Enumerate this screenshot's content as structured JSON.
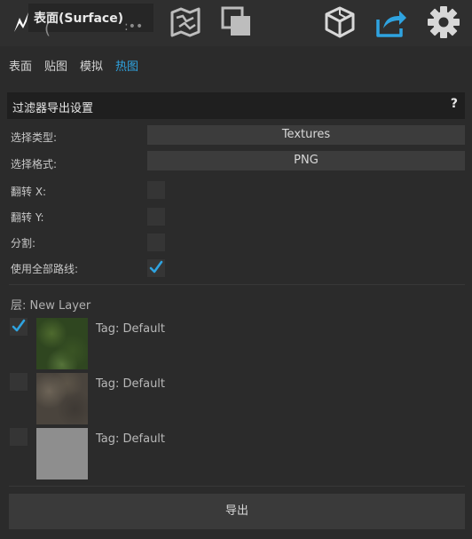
{
  "toolbar": {
    "title": "表面(Surface)",
    "icons": [
      "app-logo-icon",
      "map-icon",
      "copy-icon",
      "cube-icon",
      "share-export-icon",
      "gear-icon"
    ],
    "active_color": "#2fa3e0"
  },
  "tabs": [
    {
      "label": "表面",
      "active": false
    },
    {
      "label": "贴图",
      "active": false
    },
    {
      "label": "模拟",
      "active": false
    },
    {
      "label": "热图",
      "active": true
    }
  ],
  "panel": {
    "title": "过滤器导出设置",
    "help": "?",
    "select_type_label": "选择类型:",
    "select_type_value": "Textures",
    "select_format_label": "选择格式:",
    "select_format_value": "PNG",
    "flip_x_label": "翻转 X:",
    "flip_x_checked": false,
    "flip_y_label": "翻转 Y:",
    "flip_y_checked": false,
    "split_label": "分割:",
    "split_checked": false,
    "use_all_paths_label": "使用全部路线:",
    "use_all_paths_checked": true
  },
  "layer": {
    "label": "层: New Layer",
    "items": [
      {
        "checked": true,
        "tag": "Tag: Default",
        "texture": "grass"
      },
      {
        "checked": false,
        "tag": "Tag: Default",
        "texture": "rock"
      },
      {
        "checked": false,
        "tag": "Tag: Default",
        "texture": "flat-gray"
      }
    ]
  },
  "export_button": "导出"
}
